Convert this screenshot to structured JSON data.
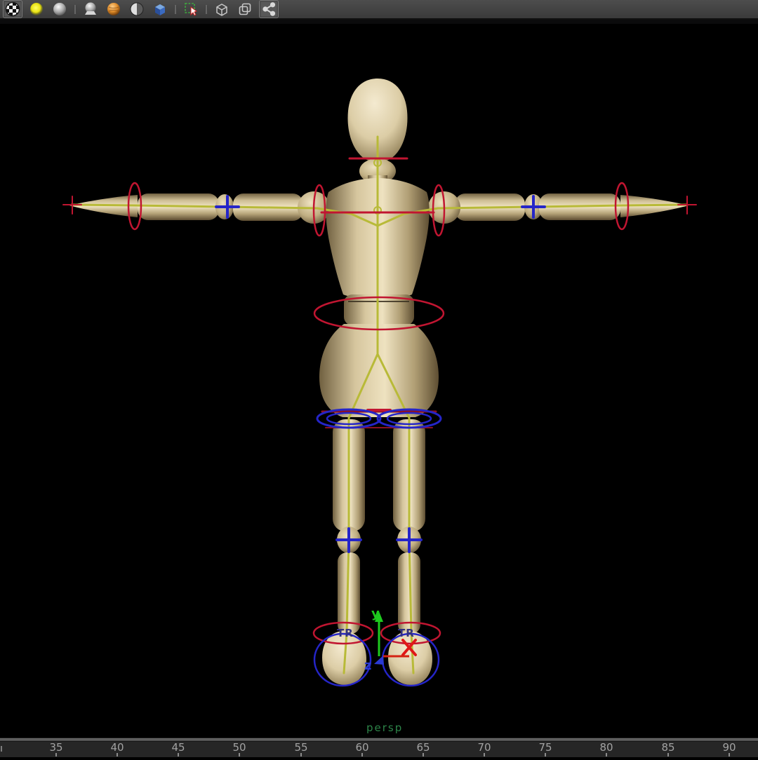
{
  "toolbar": {
    "icons": [
      {
        "name": "checker-sphere-icon",
        "pressed": true
      },
      {
        "name": "yellow-light-sphere-icon",
        "pressed": false
      },
      {
        "name": "gray-sphere-icon",
        "pressed": false
      },
      {
        "name": "sphere-on-plane-icon",
        "pressed": false
      },
      {
        "name": "orange-textured-sphere-icon",
        "pressed": false
      },
      {
        "name": "half-shaded-sphere-icon",
        "pressed": false
      },
      {
        "name": "blue-shaded-cube-icon",
        "pressed": false
      },
      {
        "name": "marquee-select-cursor-icon",
        "pressed": false
      },
      {
        "name": "wireframe-cube-icon",
        "pressed": false
      },
      {
        "name": "overlapping-squares-icon",
        "pressed": false
      },
      {
        "name": "share-network-icon",
        "pressed": true
      }
    ]
  },
  "viewport": {
    "camera_label": "persp",
    "ankle_label_left": "TR",
    "ankle_label_right": "TR",
    "axis_labels": {
      "y": "y",
      "z": "z"
    },
    "colors": {
      "background": "#000000",
      "skeleton": "#b8ba38",
      "control_red": "#c11531",
      "control_dark_red": "#8b1225",
      "control_blue": "#2525c8",
      "marker_x_red": "#e01818",
      "axis_y_green": "#1ecb1e",
      "axis_x_red": "#d42312",
      "axis_z_blue": "#2a3ad4",
      "ankle_label_blue": "#32327e",
      "camera_label_green": "#2d8549",
      "wood_light": "#f0e4c2",
      "wood_dark": "#5e4e32"
    }
  },
  "timeline": {
    "frames": [
      "35",
      "40",
      "45",
      "50",
      "55",
      "60",
      "65",
      "70",
      "75",
      "80",
      "85",
      "90"
    ]
  }
}
